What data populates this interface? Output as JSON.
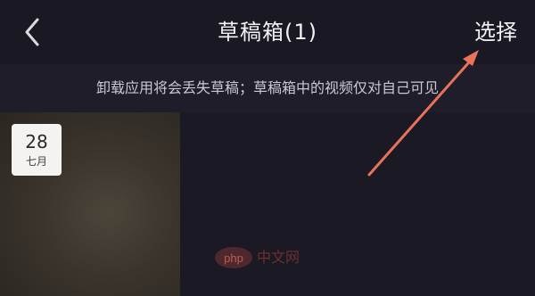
{
  "header": {
    "title": "草稿箱(1)",
    "select_label": "选择"
  },
  "notice": {
    "text": "卸载应用将会丢失草稿；草稿箱中的视频仅对自己可见"
  },
  "drafts": [
    {
      "day": "28",
      "month": "七月"
    }
  ],
  "watermark": {
    "logo_text": "php",
    "site_text": "中文网"
  },
  "colors": {
    "background": "#1b1a24",
    "text": "#f2f2f5",
    "notice_text": "#c9c9d1",
    "annotation_arrow": "#e8735a"
  }
}
